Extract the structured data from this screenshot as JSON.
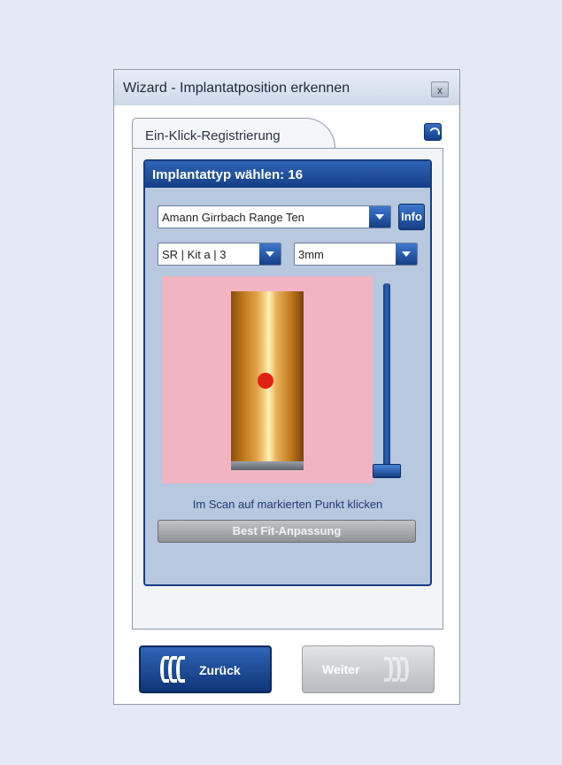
{
  "window": {
    "title": "Wizard - Implantatposition erkennen",
    "close_label": "x"
  },
  "tab": {
    "label": "Ein-Klick-Registrierung"
  },
  "group": {
    "header": "Implantattyp wählen: 16"
  },
  "selectors": {
    "manufacturer": "Amann Girrbach Range Ten",
    "kit": "SR | Kit a | 3",
    "size": "3mm",
    "info_label": "Info"
  },
  "slider": {
    "level": 0.0
  },
  "instruction": "Im Scan auf markierten Punkt klicken",
  "best_fit_label": "Best Fit-Anpassung",
  "nav": {
    "back_label": "Zurück",
    "next_label": "Weiter"
  },
  "colors": {
    "accent": "#153f86",
    "preview_bg": "#f2b4c2",
    "marker": "#e02012"
  }
}
